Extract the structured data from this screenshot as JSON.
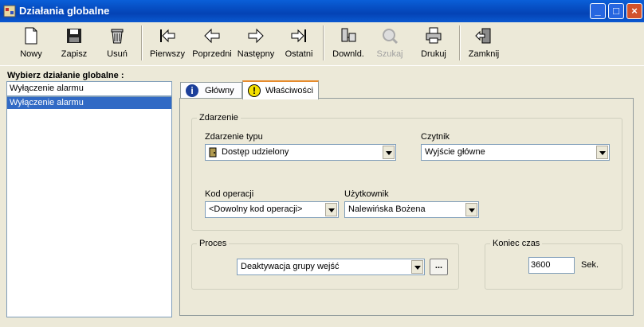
{
  "window": {
    "title": "Działania globalne"
  },
  "toolbar": {
    "nowy": "Nowy",
    "zapisz": "Zapisz",
    "usun": "Usuń",
    "pierwszy": "Pierwszy",
    "poprzedni": "Poprzedni",
    "nastepny": "Następny",
    "ostatni": "Ostatni",
    "download": "Downld.",
    "szukaj": "Szukaj",
    "drukuj": "Drukuj",
    "zamknij": "Zamknij"
  },
  "left": {
    "label": "Wybierz działanie globalne :",
    "input_value": "Wyłączenie alarmu",
    "items": [
      "Wyłączenie alarmu"
    ]
  },
  "tabs": [
    {
      "label": "Główny",
      "icon": "info-icon"
    },
    {
      "label": "Właściwości",
      "icon": "warning-icon"
    }
  ],
  "zdarzenie": {
    "legend": "Zdarzenie",
    "typ_label": "Zdarzenie typu",
    "typ_value": "Dostęp udzielony",
    "czytnik_label": "Czytnik",
    "czytnik_value": "Wyjście główne",
    "kod_label": "Kod operacji",
    "kod_value": "<Dowolny kod operacji>",
    "user_label": "Użytkownik",
    "user_value": "Nalewińska  Bożena"
  },
  "proces": {
    "legend": "Proces",
    "value": "Deaktywacja grupy wejść",
    "browse_label": "..."
  },
  "koniec": {
    "legend": "Koniec czas",
    "value": "3600",
    "unit": "Sek."
  },
  "colors": {
    "title_bar": "#0a5fd8",
    "selection": "#316ac5",
    "tab_highlight": "#e68b2c"
  }
}
